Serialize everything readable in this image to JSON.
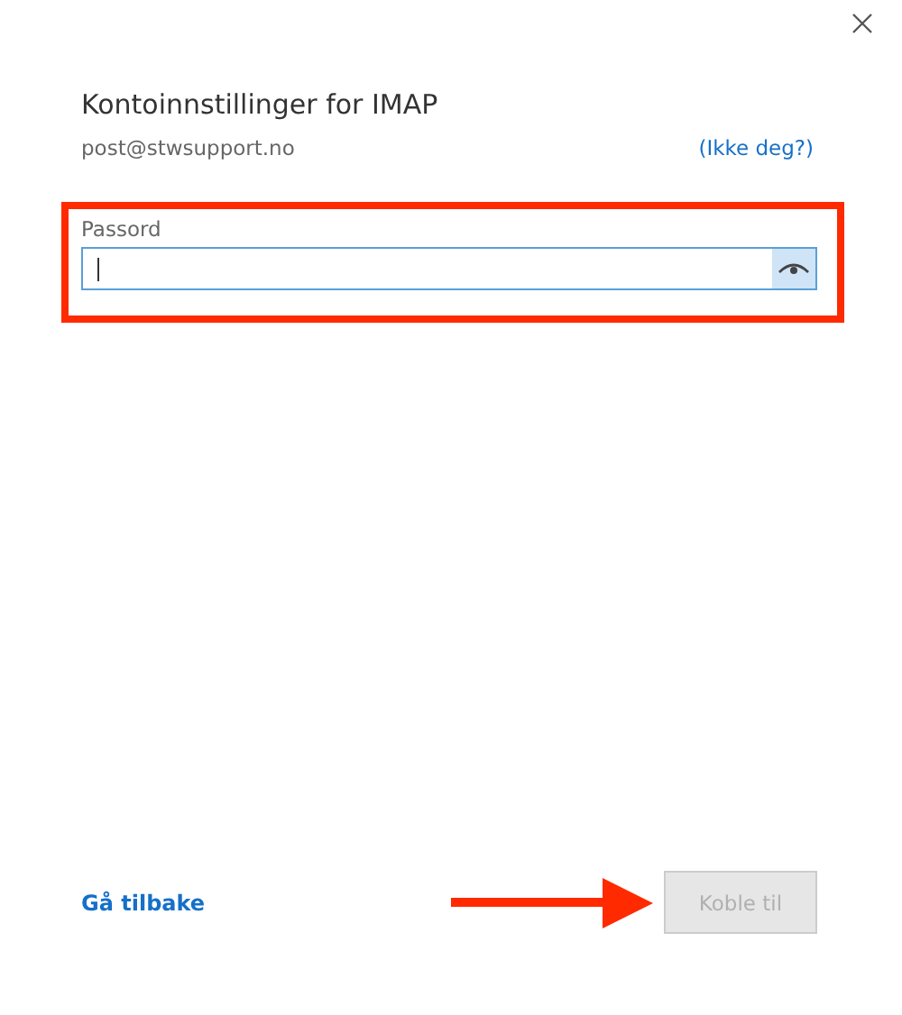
{
  "dialog": {
    "title": "Kontoinnstillinger for IMAP",
    "account": "post@stwsupport.no",
    "not_you_link": "(Ikke deg?)"
  },
  "password": {
    "label": "Passord",
    "focused": true,
    "reveal_selected": true
  },
  "annotations": {
    "highlight": true,
    "arrow": true
  },
  "footer": {
    "back_link": "Gå tilbake",
    "connect_button": {
      "label": "Koble til",
      "disabled": true
    }
  }
}
